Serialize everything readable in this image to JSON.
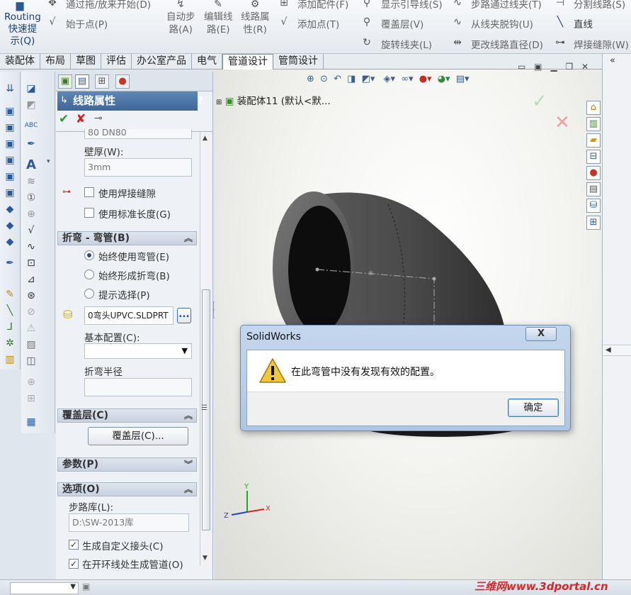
{
  "ribbon": {
    "routing_label": "Routing\n快速提\n示(Q)",
    "cmd_drag": "通过拖/放来开始(D)",
    "cmd_start_point": "始于点(P)",
    "cmd_auto_route": "自动步\n路(A)",
    "cmd_edit_route": "编辑线\n路(E)",
    "cmd_route_props": "线路属\n性(R)",
    "cmd_add_fitting": "添加配件(F)",
    "cmd_add_point": "添加点(T)",
    "cmd_show_guide": "显示引导线(S)",
    "cmd_cover": "覆盖层(V)",
    "cmd_rotate_clamp": "旋转线夹(L)",
    "cmd_step_clamp": "步路通过线夹(T)",
    "cmd_detach_clamp": "从线夹脱钩(U)",
    "cmd_change_dia": "更改线路直径(D)",
    "cmd_split_route": "分割线路(S)",
    "cmd_line": "直线",
    "cmd_weld_gap": "焊接缝隙(W)"
  },
  "tabs": [
    "装配体",
    "布局",
    "草图",
    "评估",
    "办公室产品",
    "电气",
    "管道设计",
    "管筒设计"
  ],
  "active_tab": "管道设计",
  "tree_root": "装配体11 (默认<默...",
  "pm": {
    "title": "线路属性",
    "help": "?",
    "partial_field": "80 DN80",
    "wall_label": "壁厚(W):",
    "wall_value": "3mm",
    "use_weld_gap": "使用焊接缝隙",
    "use_std_length": "使用标准长度(G)",
    "bend_section": "折弯 - 弯管(B)",
    "bend_opt1": "始终使用弯管(E)",
    "bend_opt2": "始终形成折弯(B)",
    "bend_opt3": "提示选择(P)",
    "elbow_file": "0弯头UPVC.SLDPRT",
    "browse": "...",
    "base_config_label": "基本配置(C):",
    "bend_radius_label": "折弯半径",
    "cover_section": "覆盖层(C)",
    "cover_button": "覆盖层(C)...",
    "params_section": "参数(P)",
    "options_section": "选项(O)",
    "lib_label": "步路库(L):",
    "lib_value": "D:\\SW-2013库",
    "gen_custom": "生成自定义接头(C)",
    "gen_open": "在开环线处生成管道(O)"
  },
  "dialog": {
    "title": "SolidWorks",
    "message": "在此弯管中没有发现有效的配置。",
    "ok": "确定",
    "close": "X"
  },
  "triad": {
    "x": "X",
    "y": "Y",
    "z": "Z"
  },
  "watermark": "三维网www.3dportal.cn",
  "colors": {
    "pm_header": "#4a74a6",
    "accept": "#2e9a2e",
    "reject": "#cc2222"
  }
}
